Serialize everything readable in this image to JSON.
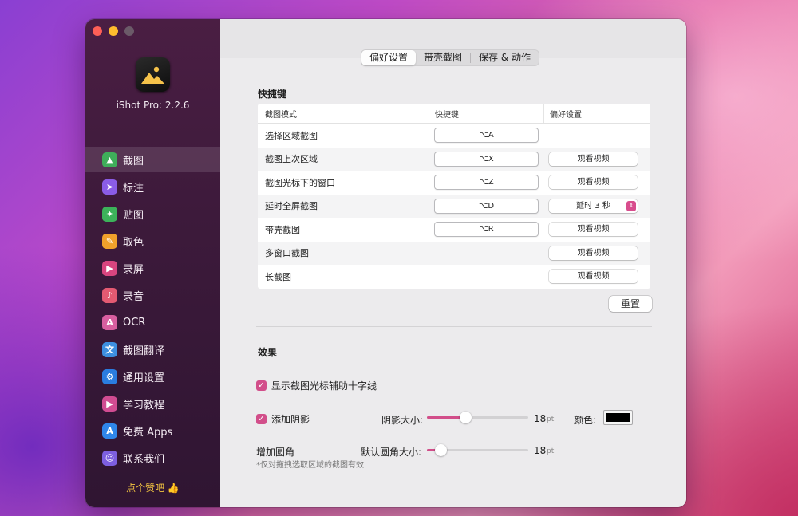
{
  "app": {
    "version_label": "iShot Pro: 2.2.6",
    "like_label": "点个赞吧 👍"
  },
  "sidebar": {
    "items": [
      {
        "label": "截图",
        "icon": "image-icon",
        "color": "#3fae5a",
        "glyph": "▲"
      },
      {
        "label": "标注",
        "icon": "cursor-arrow-icon",
        "color": "#8a5ce6",
        "glyph": "➤"
      },
      {
        "label": "贴图",
        "icon": "pin-icon",
        "color": "#3cb25a",
        "glyph": "✦"
      },
      {
        "label": "取色",
        "icon": "eyedropper-icon",
        "color": "#f0a12b",
        "glyph": "✎"
      },
      {
        "label": "录屏",
        "icon": "video-camera-icon",
        "color": "#d8457f",
        "glyph": "▶"
      },
      {
        "label": "录音",
        "icon": "microphone-icon",
        "color": "#e45a72",
        "glyph": "♪"
      },
      {
        "label": "OCR",
        "icon": "ocr-scan-icon",
        "color": "#d85fa0",
        "glyph": "A"
      },
      {
        "label": "截图翻译",
        "icon": "translate-icon",
        "color": "#3d8fe0",
        "glyph": "文"
      },
      {
        "label": "通用设置",
        "icon": "gear-icon",
        "color": "#2a7ce0",
        "glyph": "⚙"
      },
      {
        "label": "学习教程",
        "icon": "tutorial-video-icon",
        "color": "#d14c92",
        "glyph": "▶"
      },
      {
        "label": "免费 Apps",
        "icon": "app-store-icon",
        "color": "#2f86ea",
        "glyph": "A"
      },
      {
        "label": "联系我们",
        "icon": "contact-people-icon",
        "color": "#7d5fe0",
        "glyph": "☺"
      }
    ],
    "active_index": 0
  },
  "tabs": [
    {
      "label": "偏好设置",
      "active": true
    },
    {
      "label": "带壳截图",
      "active": false
    },
    {
      "label": "保存 & 动作",
      "active": false
    }
  ],
  "shortcuts": {
    "section_title": "快捷键",
    "headers": [
      "截图模式",
      "快捷键",
      "偏好设置"
    ],
    "rows": [
      {
        "mode": "选择区域截图",
        "key": "⌥A",
        "pref": ""
      },
      {
        "mode": "截图上次区域",
        "key": "⌥X",
        "pref": "观看视频"
      },
      {
        "mode": "截图光标下的窗口",
        "key": "⌥Z",
        "pref": "观看视频"
      },
      {
        "mode": "延时全屏截图",
        "key": "⌥D",
        "pref": "延时 3 秒"
      },
      {
        "mode": "带壳截图",
        "key": "⌥R",
        "pref": "观看视频"
      },
      {
        "mode": "多窗口截图",
        "key": "",
        "pref": "观看视频"
      },
      {
        "mode": "长截图",
        "key": "",
        "pref": "观看视频"
      }
    ],
    "reset_label": "重置"
  },
  "effects": {
    "section_title": "效果",
    "crosshair_label": "显示截图光标辅助十字线",
    "crosshair_checked": true,
    "shadow_label": "添加阴影",
    "shadow_checked": true,
    "shadow_size_label": "阴影大小:",
    "shadow_size_value": "18",
    "shadow_size_fraction": 0.38,
    "unit": "pt",
    "color_label": "颜色:",
    "shadow_color": "#000000",
    "corner_label": "增加圆角",
    "corner_size_label": "默认圆角大小:",
    "corner_size_value": "18",
    "corner_size_fraction": 0.13,
    "corner_note": "*仅对拖拽选取区域的截图有效"
  },
  "colors": {
    "accent": "#d24e8a"
  }
}
